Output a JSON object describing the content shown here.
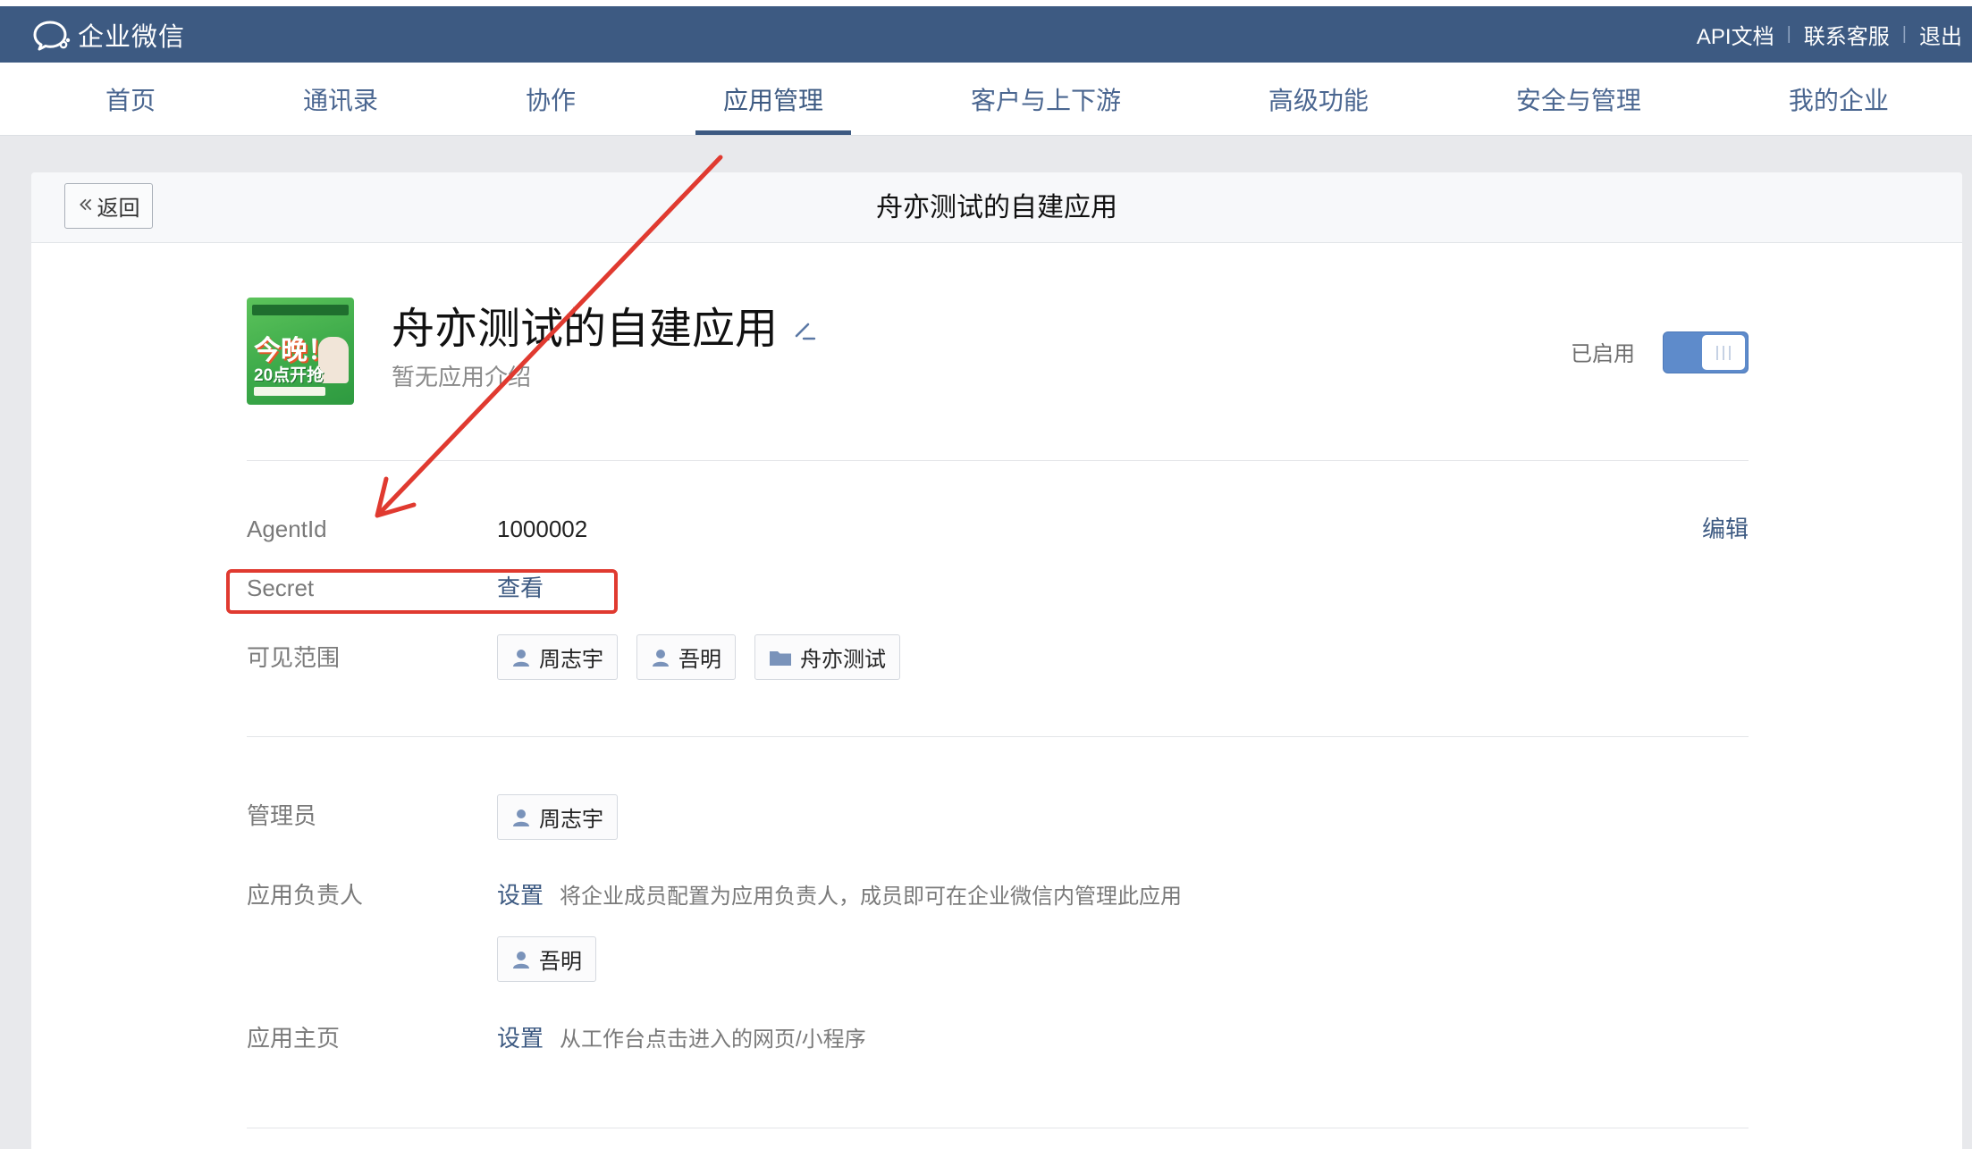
{
  "header": {
    "logo_text": "企业微信",
    "logo_icon": "wecom-logo-icon",
    "separator": "|",
    "links": [
      {
        "label": "API文档"
      },
      {
        "label": "联系客服"
      },
      {
        "label": "退出"
      }
    ]
  },
  "nav": {
    "items": [
      {
        "label": "首页"
      },
      {
        "label": "通讯录"
      },
      {
        "label": "协作"
      },
      {
        "label": "应用管理",
        "active": true
      },
      {
        "label": "客户与上下游"
      },
      {
        "label": "高级功能"
      },
      {
        "label": "安全与管理"
      },
      {
        "label": "我的企业"
      }
    ]
  },
  "card_header": {
    "back_icon": "double-chevron-left-icon",
    "back_label": "返回",
    "title": "舟亦测试的自建应用"
  },
  "app": {
    "icon": {
      "headline": "今晚！",
      "subline": "20点开抢"
    },
    "name": "舟亦测试的自建应用",
    "edit_icon": "pencil-icon",
    "description": "暂无应用介绍",
    "status_label": "已启用",
    "enabled": true
  },
  "basic": {
    "agent_id": {
      "label": "AgentId",
      "value": "1000002",
      "edit_label": "编辑"
    },
    "secret": {
      "label": "Secret",
      "action_label": "查看"
    },
    "visibility": {
      "label": "可见范围",
      "tags": [
        {
          "icon": "person-icon",
          "name": "周志宇"
        },
        {
          "icon": "person-icon",
          "name": "吾明"
        },
        {
          "icon": "folder-icon",
          "name": "舟亦测试"
        }
      ]
    }
  },
  "management": {
    "admins": {
      "label": "管理员",
      "tags": [
        {
          "icon": "person-icon",
          "name": "周志宇"
        }
      ]
    },
    "owners": {
      "label": "应用负责人",
      "action_label": "设置",
      "hint": "将企业成员配置为应用负责人，成员即可在企业微信内管理此应用",
      "tags": [
        {
          "icon": "person-icon",
          "name": "吾明"
        }
      ]
    },
    "homepage": {
      "label": "应用主页",
      "action_label": "设置",
      "hint": "从工作台点击进入的网页/小程序"
    }
  },
  "colors": {
    "header_bg": "#3D5A82",
    "accent": "#3D5A82",
    "toggle_on": "#5E8BCB",
    "annotation_red": "#E03A30",
    "page_bg": "#E8E9EC"
  }
}
